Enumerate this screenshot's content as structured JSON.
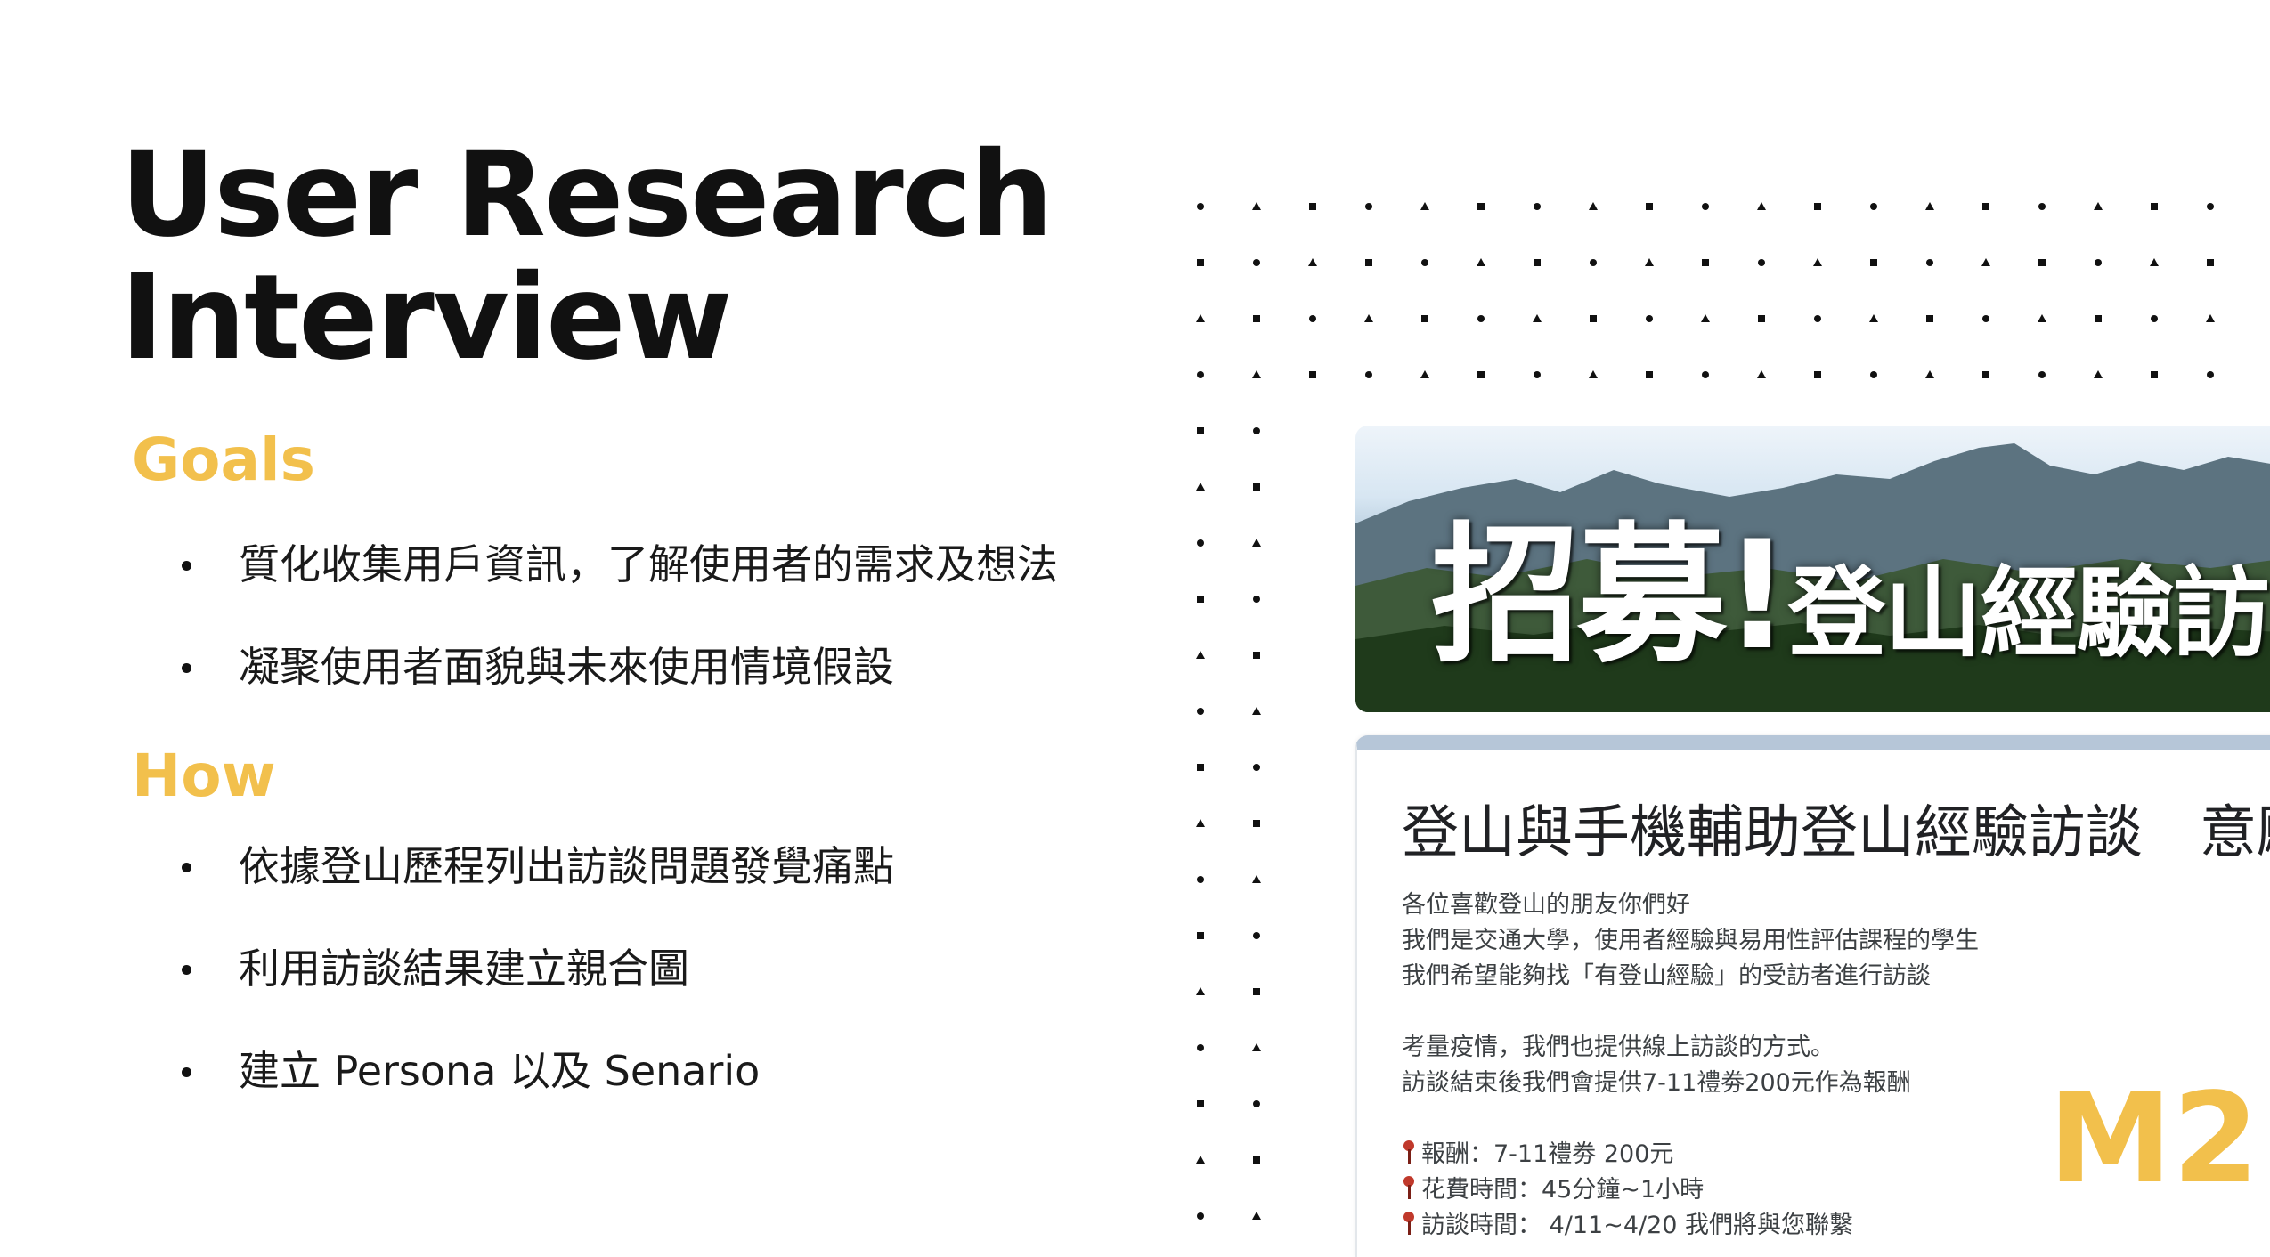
{
  "slide": {
    "title_line1": "User Research",
    "title_line2": "Interview",
    "goals": {
      "heading": "Goals",
      "items": [
        "質化收集用戶資訊，了解使用者的需求及想法",
        "凝聚使用者面貌與未來使用情境假設"
      ]
    },
    "how": {
      "heading": "How",
      "items": [
        "依據登山歷程列出訪談問題發覺痛點",
        "利用訪談結果建立親合圖",
        "建立 Persona 以及 Senario"
      ]
    },
    "watermark": "M2"
  },
  "form_preview": {
    "banner_big": "招募!",
    "banner_small": "登山經驗訪",
    "title": "登山與手機輔助登山經驗訪談　意願",
    "body_lines": [
      "各位喜歡登山的朋友你們好",
      "我們是交通大學，使用者經驗與易用性評估課程的學生",
      "我們希望能夠找「有登山經驗」的受訪者進行訪談",
      "考量疫情，我們也提供線上訪談的方式。",
      "訪談結束後我們會提供7-11禮劵200元作為報酬"
    ],
    "details": [
      "報酬：7-11禮劵 200元",
      "花費時間：45分鐘~1小時",
      "訪談時間： 4/11~4/20 我們將與您聯繫"
    ]
  },
  "colors": {
    "accent": "#f2c04c",
    "text": "#111111",
    "form_header": "#b6c6d8"
  },
  "icons": {
    "bullet": "bullet-dot-icon",
    "detail_marker": "pushpin-icon"
  }
}
